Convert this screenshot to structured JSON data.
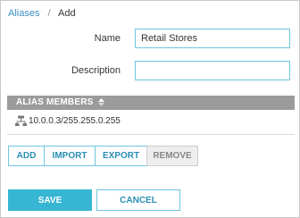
{
  "breadcrumb": {
    "parent": "Aliases",
    "separator": "/",
    "current": "Add"
  },
  "form": {
    "name_label": "Name",
    "name_value": "Retail Stores",
    "description_label": "Description",
    "description_value": ""
  },
  "members_table": {
    "header": "ALIAS MEMBERS",
    "sort_icon": "sort-ascending-icon",
    "rows": [
      {
        "icon": "network-icon",
        "value": "10.0.0.3/255.255.0.255"
      }
    ]
  },
  "member_actions": {
    "add": "ADD",
    "import": "IMPORT",
    "export": "EXPORT",
    "remove": "REMOVE"
  },
  "footer": {
    "save": "SAVE",
    "cancel": "CANCEL"
  },
  "colors": {
    "accent": "#37b6d4",
    "link": "#3b8fc4",
    "header_bg": "#9b9b9b",
    "disabled_bg": "#eeeeee"
  }
}
